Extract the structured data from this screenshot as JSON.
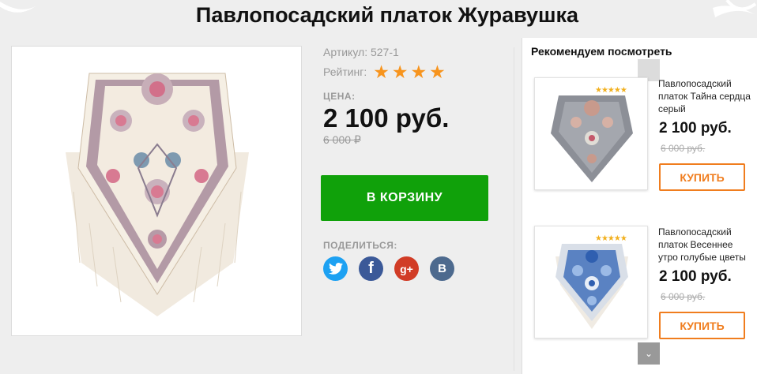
{
  "product": {
    "title": "Павлопосадский платок Журавушка",
    "sku": "Артикул: 527-1",
    "rating_label": "Рейтинг:",
    "rating": 4,
    "price_label": "ЦЕНА:",
    "price": "2 100 руб.",
    "old_price": "6 000 ₽",
    "cart_button": "В КОРЗИНУ",
    "share_label": "ПОДЕЛИТЬСЯ:",
    "share_icons": [
      "twitter-icon",
      "facebook-icon",
      "google-plus-icon",
      "vk-icon"
    ],
    "share_glyphs": {
      "facebook": "f",
      "google_plus": "g+",
      "vk": "B"
    }
  },
  "recommended": {
    "title": "Рекомендуем посмотреть",
    "items": [
      {
        "name": "Павлопосадский платок Тайна сердца серый",
        "price": "2 100 руб.",
        "old_price": "6 000 руб.",
        "stars": "★★★★★",
        "rating": 5,
        "buy_label": "КУПИТЬ"
      },
      {
        "name": "Павлопосадский платок Весеннее утро голубые цветы",
        "price": "2 100 руб.",
        "old_price": "6 000 руб.",
        "stars": "★★★★★",
        "rating": 4.5,
        "buy_label": "КУПИТЬ"
      }
    ]
  },
  "colors": {
    "cart_green": "#10a10a",
    "star_orange": "#f7941d",
    "buy_orange": "#f07d1e"
  }
}
